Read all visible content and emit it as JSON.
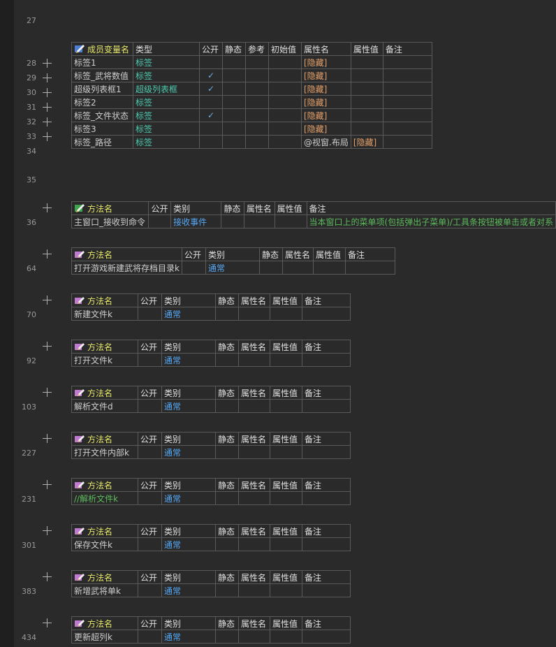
{
  "line_numbers": [
    "27",
    "28",
    "29",
    "30",
    "31",
    "32",
    "33",
    "34",
    "35",
    "36",
    "64",
    "70",
    "92",
    "103",
    "227",
    "231",
    "301",
    "383",
    "434"
  ],
  "vars_header": [
    "成员变量名",
    "类型",
    "公开",
    "静态",
    "参考",
    "初始值",
    "属性名",
    "属性值",
    "备注"
  ],
  "vars_rows": [
    {
      "name": "标签1",
      "type": "标签",
      "public": "",
      "attr": "[隐藏]",
      "attrval": ""
    },
    {
      "name": "标签_武将数值",
      "type": "标签",
      "public": "✓",
      "attr": "[隐藏]",
      "attrval": ""
    },
    {
      "name": "超级列表框1",
      "type": "超级列表框",
      "public": "✓",
      "attr": "[隐藏]",
      "attrval": ""
    },
    {
      "name": "标签2",
      "type": "标签",
      "public": "",
      "attr": "[隐藏]",
      "attrval": ""
    },
    {
      "name": "标签_文件状态",
      "type": "标签",
      "public": "✓",
      "attr": "[隐藏]",
      "attrval": ""
    },
    {
      "name": "标签3",
      "type": "标签",
      "public": "",
      "attr": "[隐藏]",
      "attrval": ""
    },
    {
      "name": "标签_路径",
      "type": "标签",
      "public": "",
      "attr": "@视窗.布局",
      "attrval": "[隐藏]"
    }
  ],
  "method_header": [
    "方法名",
    "公开",
    "类别",
    "静态",
    "属性名",
    "属性值",
    "备注"
  ],
  "methods": [
    {
      "name": "主窗口_接收到命令",
      "category": "接收事件",
      "note": "当本窗口上的菜单项(包括弹出子菜单)/工具条按钮被单击或者对系"
    },
    {
      "name": "打开游戏新建武将存档目录k",
      "category": "通常",
      "note": ""
    },
    {
      "name": "新建文件k",
      "category": "通常",
      "note": ""
    },
    {
      "name": "打开文件k",
      "category": "通常",
      "note": ""
    },
    {
      "name": "解析文件d",
      "category": "通常",
      "note": ""
    },
    {
      "name": "打开文件内部k",
      "category": "通常",
      "note": ""
    },
    {
      "name": "//解析文件k",
      "category": "通常",
      "note": ""
    },
    {
      "name": "保存文件k",
      "category": "通常",
      "note": ""
    },
    {
      "name": "新增武将单k",
      "category": "通常",
      "note": ""
    },
    {
      "name": "更新超列k",
      "category": "通常",
      "note": ""
    }
  ],
  "colors": {
    "background": "#2a2a2a",
    "border": "#5a5a5a",
    "type": "#4ec9b0",
    "category": "#56a8f5",
    "hidden": "#e3a06b",
    "comment": "#5dbb5d"
  }
}
